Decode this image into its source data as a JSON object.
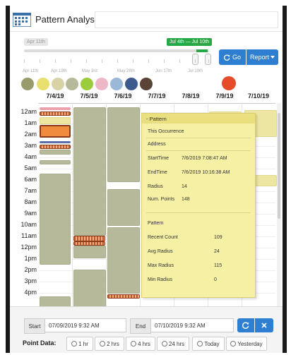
{
  "app": {
    "title": "Pattern Analysis",
    "icon": "calendar-grid-icon"
  },
  "slider": {
    "range_start_label": "Apr 11th",
    "selected_range_label": "Jul 4th — Jul 10th",
    "tick_labels": [
      "Apr 11th",
      "Apr 19th",
      "May 3rd",
      "May 28th",
      "Jun 17th",
      "Jul 10th"
    ],
    "selection_start_fraction": 0.93,
    "selection_end_fraction": 1.0
  },
  "toolbar": {
    "go_label": "Go",
    "report_label": "Report",
    "go_icon": "refresh-icon",
    "report_icon": "caret-down-icon"
  },
  "colors": {
    "accent": "#2e7fd1",
    "range_green": "#28a745",
    "event_green": "#b7b99b",
    "event_yellow": "#ede6a2",
    "popup_bg": "#f6f0a4",
    "legend": [
      "#9a9b6b",
      "#e8df6f",
      "#d8d3a6",
      "#b7b99b",
      "#9ccc3c",
      "#efb8c8",
      "#9ab8d8",
      "#3d5a8f",
      "#5b4437",
      "#e74c2a"
    ]
  },
  "calendar": {
    "dates": [
      "7/4/19",
      "7/5/19",
      "7/6/19",
      "7/7/19",
      "7/8/19",
      "7/9/19",
      "7/10/19"
    ],
    "hours": [
      "12am",
      "1am",
      "2am",
      "3am",
      "4am",
      "5am",
      "6am",
      "7am",
      "8am",
      "9am",
      "10am",
      "11am",
      "12pm",
      "1pm",
      "2pm",
      "3pm",
      "4pm"
    ]
  },
  "popup": {
    "header": "- Pattern",
    "section1": "This Occurrence",
    "address_label": "Address",
    "start_time_label": "StartTime",
    "start_time_value": "7/6/2019 7:08:47 AM",
    "end_time_label": "EndTime",
    "end_time_value": "7/6/2019 10:16:38 AM",
    "radius_label": "Radius",
    "radius_value": "14",
    "num_points_label": "Num. Points",
    "num_points_value": "148",
    "section2": "Pattern",
    "recent_count_label": "Recent Count",
    "recent_count_value": "109",
    "avg_radius_label": "Avg Radius",
    "avg_radius_value": "24",
    "max_radius_label": "Max Radius",
    "max_radius_value": "115",
    "min_radius_label": "Min Radius",
    "min_radius_value": "0"
  },
  "filters": {
    "start_label": "Start",
    "start_value": "07/09/2019 9:32 AM",
    "end_label": "End",
    "end_value": "07/10/2019 9:32 AM",
    "point_data_label": "Point Data:",
    "options": [
      "1 hr",
      "2 hrs",
      "4 hrs",
      "24 hrs",
      "Today",
      "Yesterday"
    ]
  }
}
